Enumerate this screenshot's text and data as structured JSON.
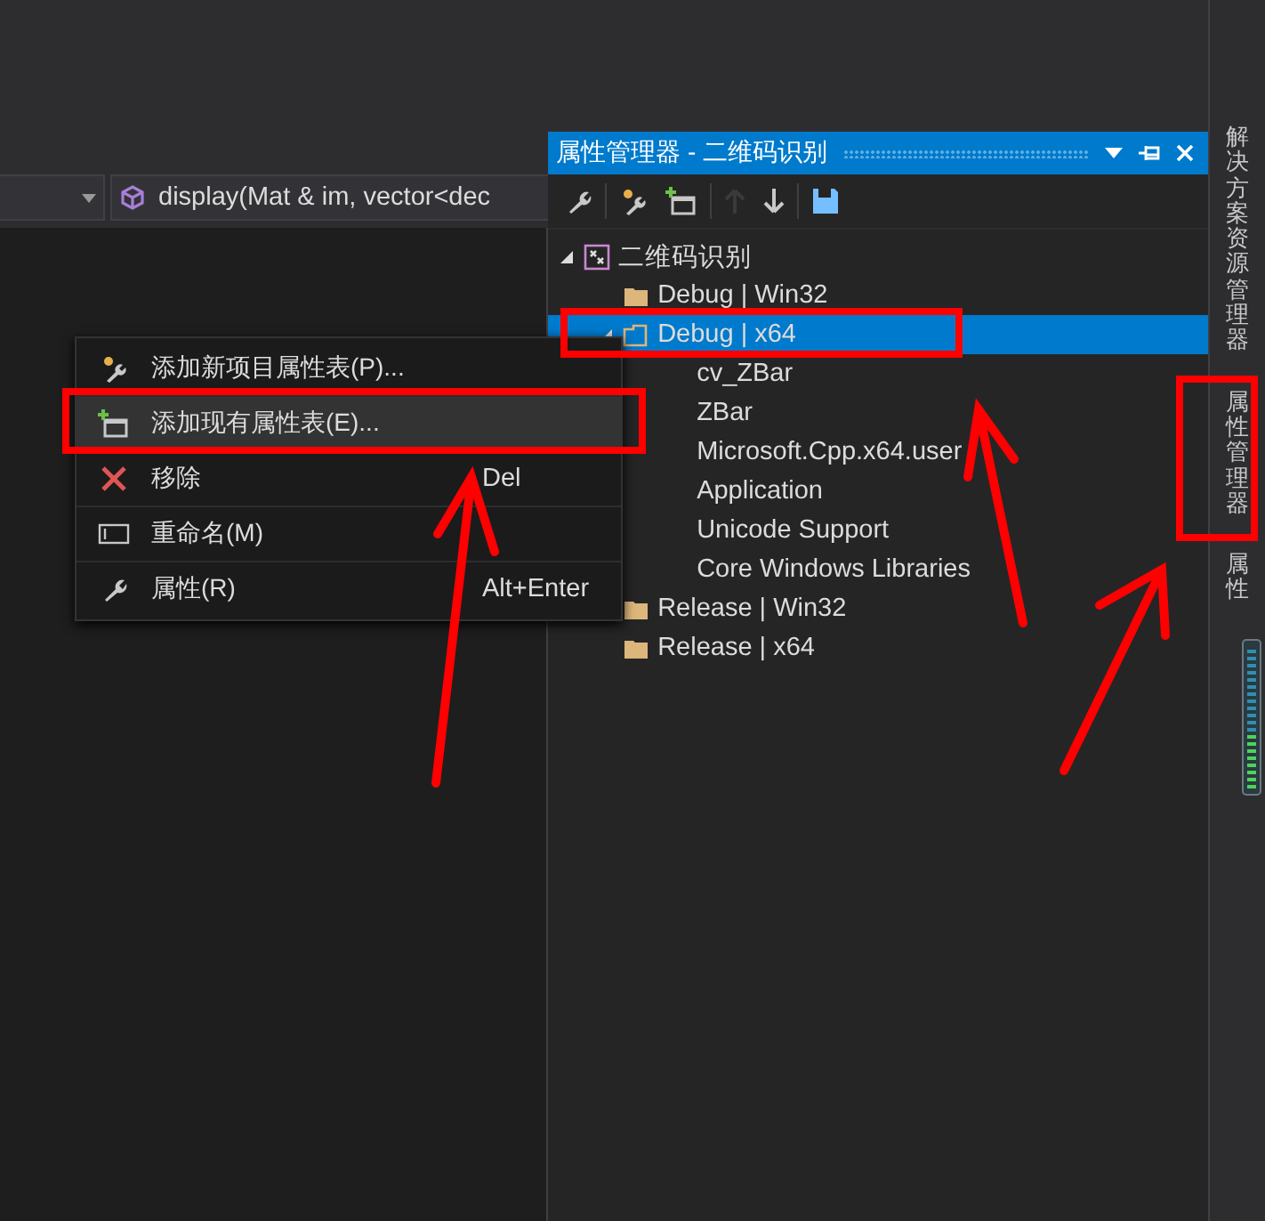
{
  "editor_nav": {
    "member_dropdown": "display(Mat & im, vector<dec"
  },
  "panel": {
    "title": "属性管理器 - 二维码识别",
    "toolbar": [
      {
        "kind": "properties",
        "disabled": false
      },
      {
        "kind": "add-new",
        "disabled": false
      },
      {
        "kind": "add-existing",
        "disabled": false
      },
      {
        "kind": "up",
        "disabled": true
      },
      {
        "kind": "down",
        "disabled": false
      },
      {
        "kind": "save",
        "disabled": false
      }
    ],
    "tree": [
      {
        "label": "二维码识别",
        "kind": "project",
        "expanded": true,
        "selected": false,
        "children": [
          {
            "label": "Debug | Win32",
            "kind": "config",
            "expanded": false,
            "selected": false
          },
          {
            "label": "Debug | x64",
            "kind": "config",
            "expanded": true,
            "selected": true,
            "children": [
              {
                "label": "cv_ZBar",
                "kind": "sheet",
                "selected": false
              },
              {
                "label": "ZBar",
                "kind": "sheet",
                "selected": false
              },
              {
                "label": "Microsoft.Cpp.x64.user",
                "kind": "sheet",
                "selected": false
              },
              {
                "label": "Application",
                "kind": "sheet",
                "selected": false
              },
              {
                "label": "Unicode Support",
                "kind": "sheet",
                "selected": false
              },
              {
                "label": "Core Windows Libraries",
                "kind": "sheet",
                "selected": false
              }
            ]
          },
          {
            "label": "Release | Win32",
            "kind": "config",
            "expanded": false,
            "selected": false
          },
          {
            "label": "Release | x64",
            "kind": "config",
            "expanded": false,
            "selected": false
          }
        ]
      }
    ]
  },
  "side_tabs": [
    {
      "label": "解决方案资源管理器"
    },
    {
      "label": "属性管理器"
    },
    {
      "label": "属性"
    }
  ],
  "context_menu": [
    {
      "label": "添加新项目属性表(P)...",
      "kind": "add-new",
      "selected": false
    },
    {
      "label": "添加现有属性表(E)...",
      "kind": "add-existing",
      "selected": true
    },
    {
      "label": "移除",
      "shortcut": "Del",
      "kind": "remove",
      "selected": false
    },
    {
      "label": "重命名(M)",
      "kind": "rename",
      "selected": false
    },
    {
      "label": "属性(R)",
      "shortcut": "Alt+Enter",
      "kind": "properties",
      "selected": false
    }
  ]
}
